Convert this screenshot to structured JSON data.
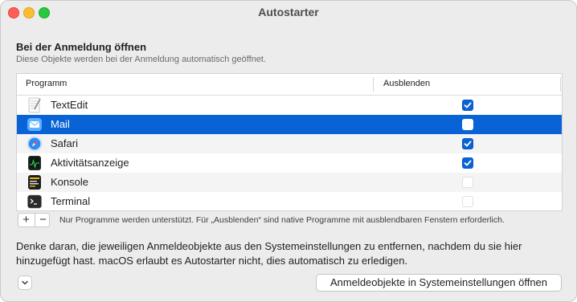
{
  "window": {
    "title": "Autostarter"
  },
  "section": {
    "title": "Bei der Anmeldung öffnen",
    "subtitle": "Diese Objekte werden bei der Anmeldung automatisch geöffnet."
  },
  "table": {
    "columns": [
      "Programm",
      "Ausblenden"
    ],
    "rows": [
      {
        "name": "TextEdit",
        "icon": "textedit-icon",
        "hide": true,
        "selected": false
      },
      {
        "name": "Mail",
        "icon": "mail-icon",
        "hide": false,
        "selected": true
      },
      {
        "name": "Safari",
        "icon": "safari-icon",
        "hide": true,
        "selected": false
      },
      {
        "name": "Aktivitätsanzeige",
        "icon": "activity-monitor-icon",
        "hide": true,
        "selected": false
      },
      {
        "name": "Konsole",
        "icon": "console-icon",
        "hide": false,
        "selected": false
      },
      {
        "name": "Terminal",
        "icon": "terminal-icon",
        "hide": false,
        "selected": false
      }
    ]
  },
  "toolbar": {
    "add_label": "+",
    "remove_label": "−",
    "hint": "Nur Programme werden unterstützt. Für „Ausblenden“ sind native Programme mit ausblendbaren Fenstern erforderlich."
  },
  "note": "Denke daran, die jeweiligen Anmeldeobjekte aus den Systemeinstellungen zu entfernen, nachdem du sie hier hinzugefügt hast. macOS erlaubt es Autostarter nicht, dies automatisch zu erledigen.",
  "footer": {
    "open_settings_label": "Anmeldeobjekte in Systemeinstellungen öffnen"
  },
  "colors": {
    "accent": "#0a63d6",
    "window_bg": "#ececec"
  }
}
